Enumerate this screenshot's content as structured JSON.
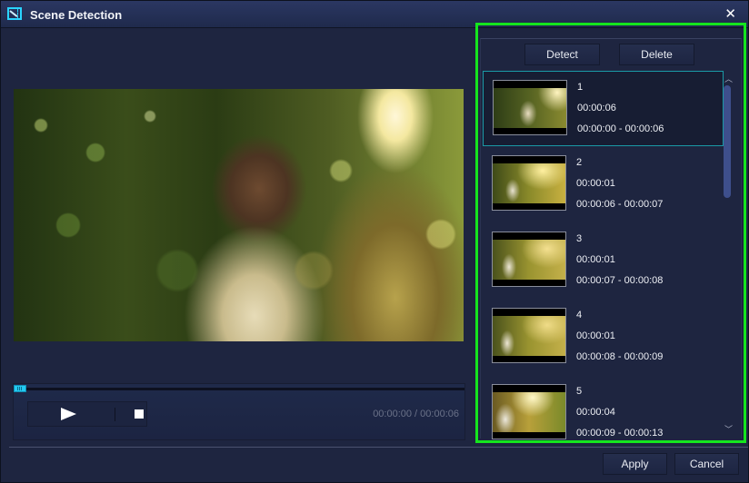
{
  "window": {
    "title": "Scene Detection",
    "app_icon": "scene-detection-icon",
    "close_glyph": "✕"
  },
  "player": {
    "progress_fraction": 0.0,
    "current_time": "00:00:00",
    "total_time": "00:00:06",
    "time_readout": "00:00:00 / 00:00:06",
    "play_icon": "play-icon",
    "stop_icon": "stop-icon"
  },
  "panel": {
    "detect_label": "Detect",
    "delete_label": "Delete",
    "selected_index": 0,
    "scenes": [
      {
        "number": "1",
        "duration": "00:00:06",
        "range": "00:00:00 - 00:00:06"
      },
      {
        "number": "2",
        "duration": "00:00:01",
        "range": "00:00:06 - 00:00:07"
      },
      {
        "number": "3",
        "duration": "00:00:01",
        "range": "00:00:07 - 00:00:08"
      },
      {
        "number": "4",
        "duration": "00:00:01",
        "range": "00:00:08 - 00:00:09"
      },
      {
        "number": "5",
        "duration": "00:00:04",
        "range": "00:00:09 - 00:00:13"
      }
    ],
    "scroll_up_glyph": "︿",
    "scroll_down_glyph": "﹀"
  },
  "footer": {
    "apply_label": "Apply",
    "cancel_label": "Cancel"
  },
  "colors": {
    "accent": "#24c9f0",
    "selection_border": "#1a9aa6",
    "panel_highlight": "#15e51e",
    "background": "#1e2540"
  }
}
